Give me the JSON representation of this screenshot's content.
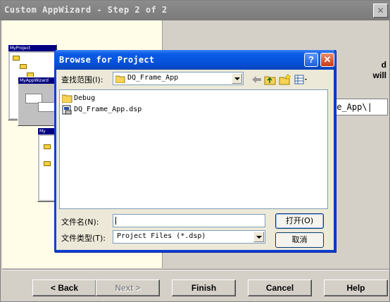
{
  "wizard": {
    "title": "Custom AppWizard - Step 2 of 2",
    "close_glyph": "✕",
    "right_text_1": "d",
    "right_text_2": "will",
    "path_field_value": "me_App\\|",
    "illustration": {
      "window1_title": "MyProject",
      "window2_title": "MyAppWizard",
      "window3_title": "My"
    },
    "buttons": {
      "back": "< Back",
      "next": "Next >",
      "finish": "Finish",
      "cancel": "Cancel",
      "help": "Help"
    }
  },
  "dialog": {
    "title": "Browse for Project",
    "help_glyph": "?",
    "close_glyph": "✕",
    "look_in_label": "查找范围(I):",
    "look_in_value": "DQ_Frame_App",
    "toolbar_icons": [
      "back-arrow-icon",
      "up-folder-icon",
      "new-folder-icon",
      "view-menu-icon"
    ],
    "files": [
      {
        "name": "Debug",
        "icon": "folder-icon"
      },
      {
        "name": "DQ_Frame_App.dsp",
        "icon": "dsp-file-icon"
      }
    ],
    "filename_label": "文件名(N):",
    "filename_value": "",
    "filetype_label": "文件类型(T):",
    "filetype_value": "Project Files (*.dsp)",
    "open_label": "打开(O)",
    "cancel_label": "取消"
  },
  "colors": {
    "dialog_title": "#0650d8",
    "wizard_face": "#d4d0c8",
    "illustration_bg": "#fffde7"
  }
}
